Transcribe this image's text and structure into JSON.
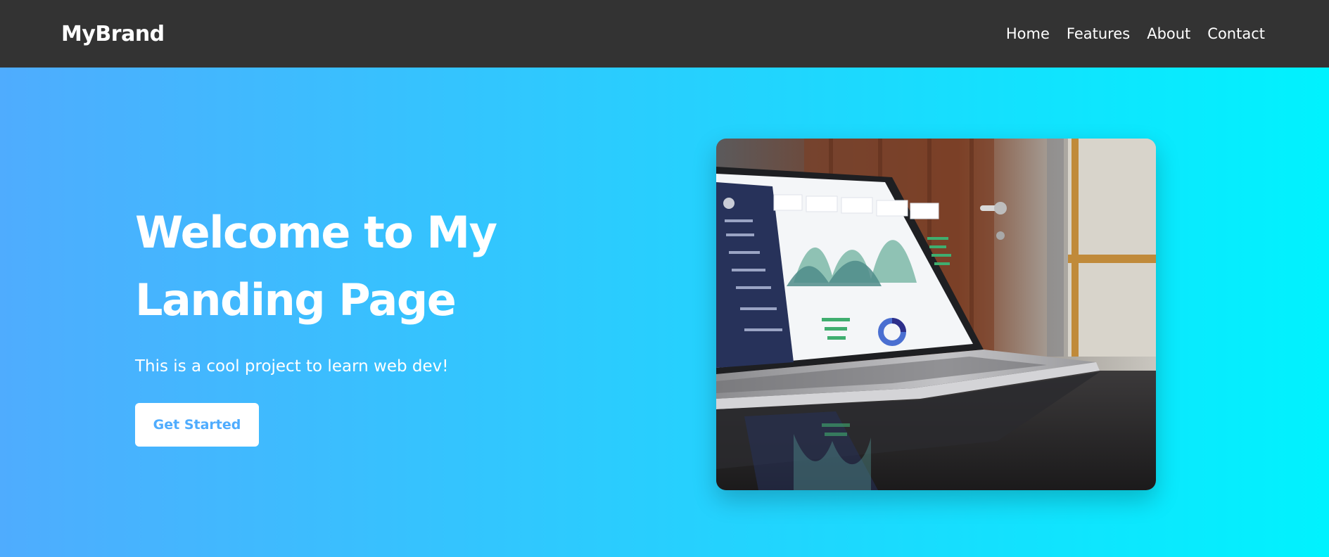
{
  "brand": "MyBrand",
  "nav": {
    "items": [
      {
        "label": "Home"
      },
      {
        "label": "Features"
      },
      {
        "label": "About"
      },
      {
        "label": "Contact"
      }
    ]
  },
  "hero": {
    "title": "Welcome to My Landing Page",
    "subtitle": "This is a cool project to learn web dev!",
    "cta_label": "Get Started"
  },
  "colors": {
    "navbar_bg": "#333333",
    "gradient_start": "#4facfe",
    "gradient_end": "#00f2fe",
    "cta_text": "#4facfe"
  }
}
